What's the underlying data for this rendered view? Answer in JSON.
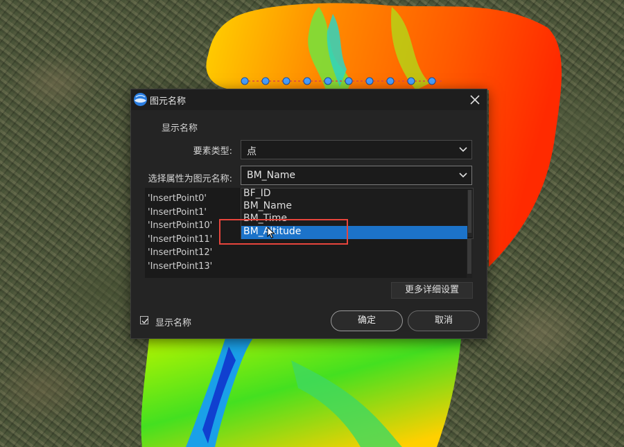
{
  "dialog": {
    "title": "图元名称",
    "section_label": "显示名称",
    "feature_type_label": "要素类型:",
    "feature_type_value": "点",
    "attr_label": "选择属性为图元名称:",
    "attr_value": "BM_Name",
    "list_items": [
      "'InsertPoint0'",
      "'InsertPoint1'",
      "'InsertPoint10'",
      "'InsertPoint11'",
      "'InsertPoint12'",
      "'InsertPoint13'"
    ],
    "dropdown_options": [
      "BF_ID",
      "BM_Name",
      "BM_Time",
      "BM_Altitude"
    ],
    "dropdown_selected": "BM_Altitude",
    "more_settings_label": "更多详细设置",
    "show_name_checkbox_label": "显示名称",
    "show_name_checked": true,
    "ok_label": "确定",
    "cancel_label": "取消"
  },
  "colors": {
    "accent": "#1c73c9",
    "highlight": "#e8453c",
    "dialog_bg": "#242424"
  }
}
